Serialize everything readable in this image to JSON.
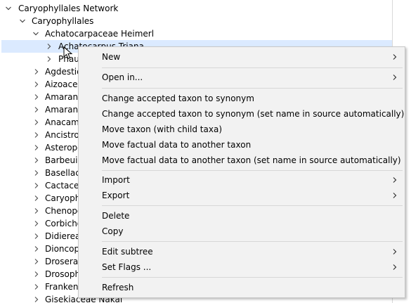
{
  "tree": {
    "root": "Caryophyllales Network",
    "order": "Caryophyllales",
    "family": "Achatocarpaceae Heimerl",
    "selected_child": "Achatocarpus Triana",
    "second_child": "Phaulothamnus",
    "families": [
      "Agdestidaceae",
      "Aizoaceae",
      "Amaranthaceae",
      "Amaranthaceae",
      "Anacampserotaceae",
      "Ancistrocladaceae",
      "Asteropeiaceae",
      "Barbeuiaceae",
      "Basellaceae",
      "Cactaceae",
      "Caryophyllaceae",
      "Chenopodiaceae",
      "Corbichoniaceae",
      "Didiereaceae",
      "Dioncophyllaceae",
      "Droseraceae",
      "Drosophyllaceae",
      "Frankeniaceae",
      "Gisekiaceae Nakai"
    ]
  },
  "context_menu": {
    "new": "New",
    "open_in": "Open in...",
    "change_to_synonym": "Change accepted taxon to synonym",
    "change_to_synonym_auto": "Change accepted taxon to synonym (set name in source automatically)",
    "move_taxon": "Move taxon (with child taxa)",
    "move_factual": "Move factual data to another taxon",
    "move_factual_auto": "Move factual data to another taxon (set name in source automatically)",
    "import": "Import",
    "export": "Export",
    "delete": "Delete",
    "copy": "Copy",
    "edit_subtree": "Edit subtree",
    "set_flags": "Set Flags ...",
    "refresh": "Refresh"
  },
  "colors": {
    "selection": "#dbeaff",
    "menu_background": "#f2f2f2",
    "menu_separator": "#d7d7d7"
  },
  "icons": {
    "expanded": "chevron-down-icon",
    "collapsed": "chevron-right-icon",
    "submenu": "submenu-arrow-icon",
    "cursor": "mouse-cursor-icon"
  }
}
